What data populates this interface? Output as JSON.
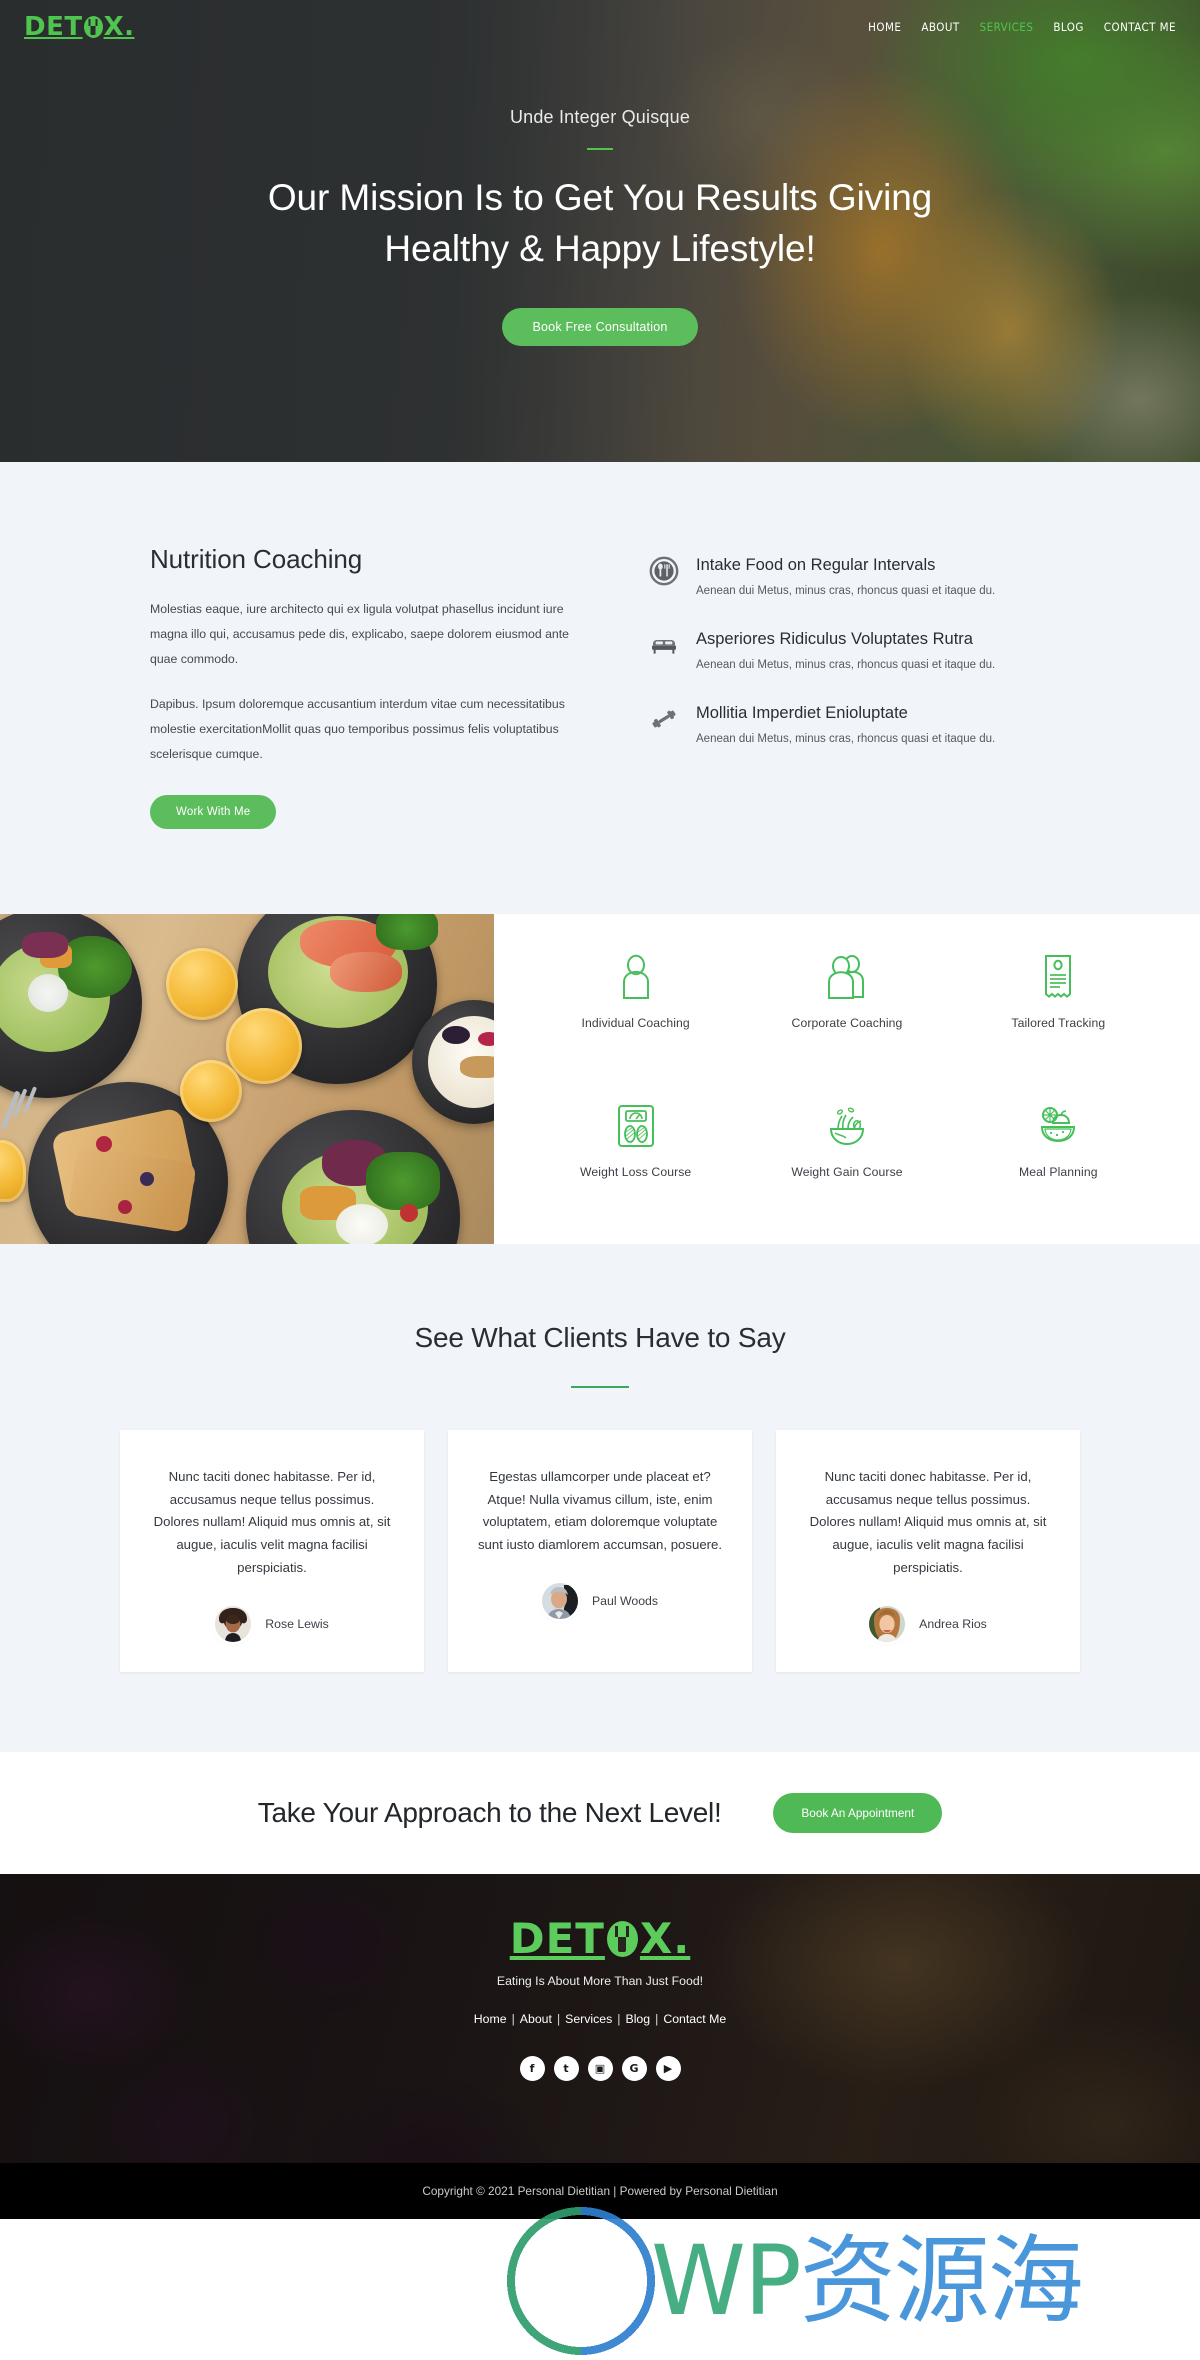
{
  "brand": {
    "name_part1": "DET",
    "name_part2": "X.",
    "logo_icon": "fork-in-circle-icon",
    "accent_green": "#4fc44f",
    "button_green": "#5bbd5b",
    "dark_bg": "#2a2d2c",
    "light_bg": "#f1f4f8"
  },
  "nav": {
    "items": [
      {
        "label": "HOME",
        "active": false
      },
      {
        "label": "ABOUT",
        "active": false
      },
      {
        "label": "SERVICES",
        "active": true
      },
      {
        "label": "BLOG",
        "active": false
      },
      {
        "label": "CONTACT ME",
        "active": false
      }
    ]
  },
  "hero": {
    "eyebrow": "Unde Integer Quisque",
    "title_line1": "Our Mission Is to Get You Results Giving",
    "title_line2": "Healthy & Happy Lifestyle!",
    "cta_label": "Book Free Consultation",
    "background_image": "blurred-sushi-and-greens-photo"
  },
  "coaching": {
    "heading": "Nutrition Coaching",
    "paragraph1": "Molestias eaque, iure architecto qui ex ligula volutpat phasellus incidunt iure magna illo qui, accusamus pede dis, explicabo, saepe dolorem eiusmod ante quae commodo.",
    "paragraph2": "Dapibus. Ipsum doloremque accusantium interdum vitae cum necessitatibus molestie exercitationMollit quas quo temporibus possimus felis voluptatibus scelerisque cumque.",
    "cta_label": "Work With Me",
    "features": [
      {
        "icon": "plate-fork-spoon-icon",
        "title": "Intake Food on Regular Intervals",
        "desc": "Aenean dui Metus, minus cras, rhoncus quasi et itaque du."
      },
      {
        "icon": "bed-icon",
        "title": "Asperiores Ridiculus Voluptates Rutra",
        "desc": "Aenean dui Metus, minus cras, rhoncus quasi et itaque du."
      },
      {
        "icon": "dumbbell-icon",
        "title": "Mollitia Imperdiet Enioluptate",
        "desc": "Aenean dui Metus, minus cras, rhoncus quasi et itaque du."
      }
    ]
  },
  "services": {
    "photo": "overhead-brunch-table-photo",
    "items": [
      {
        "icon": "single-person-icon",
        "label": "Individual Coaching"
      },
      {
        "icon": "two-people-icon",
        "label": "Corporate Coaching"
      },
      {
        "icon": "receipt-checklist-icon",
        "label": "Tailored Tracking"
      },
      {
        "icon": "weight-scale-icon",
        "label": "Weight Loss Course"
      },
      {
        "icon": "salad-bowl-icon",
        "label": "Weight Gain Course"
      },
      {
        "icon": "fruit-plate-icon",
        "label": "Meal Planning"
      }
    ]
  },
  "testimonials": {
    "heading": "See What Clients Have to Say",
    "cards": [
      {
        "quote": "Nunc taciti donec habitasse. Per id, accusamus neque tellus possimus. Dolores nullam! Aliquid mus omnis at, sit augue, iaculis velit magna facilisi perspiciatis.",
        "name": "Rose Lewis",
        "avatar": "woman-curly-hair-avatar"
      },
      {
        "quote": "Egestas ullamcorper unde placeat et? Atque! Nulla vivamus cillum, iste, enim voluptatem, etiam doloremque voluptate sunt iusto diamlorem accumsan, posuere.",
        "name": "Paul Woods",
        "avatar": "man-grey-hair-avatar"
      },
      {
        "quote": "Nunc taciti donec habitasse. Per id, accusamus neque tellus possimus. Dolores nullam! Aliquid mus omnis at, sit augue, iaculis velit magna facilisi perspiciatis.",
        "name": "Andrea Rios",
        "avatar": "woman-blonde-hair-avatar"
      }
    ]
  },
  "cta_band": {
    "heading": "Take Your Approach to the Next Level!",
    "button_label": "Book An Appointment"
  },
  "footer": {
    "logo_part1": "DET",
    "logo_part2": "X.",
    "tagline": "Eating Is About More Than Just Food!",
    "nav": [
      "Home",
      "About",
      "Services",
      "Blog",
      "Contact Me"
    ],
    "separator": "|",
    "social": [
      {
        "icon": "facebook-icon",
        "glyph": "f"
      },
      {
        "icon": "twitter-icon",
        "glyph": "t"
      },
      {
        "icon": "instagram-icon",
        "glyph": "▣"
      },
      {
        "icon": "google-icon",
        "glyph": "G"
      },
      {
        "icon": "youtube-icon",
        "glyph": "▶"
      }
    ],
    "copyright": "Copyright © 2021 Personal Dietitian | Powered by Personal Dietitian",
    "background_image": "dark-blackberries-photo"
  },
  "watermark": {
    "logo": "wordpress-logo",
    "text_latin": "WP",
    "text_cjk": "资源海",
    "color_green": "#37a878",
    "color_blue": "#3b8ed8"
  }
}
